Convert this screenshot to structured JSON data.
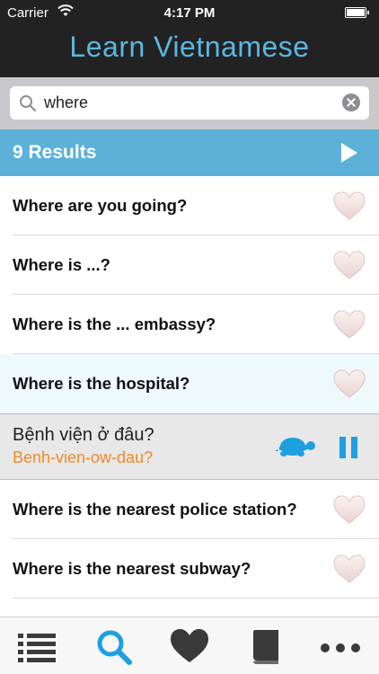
{
  "status_bar": {
    "carrier": "Carrier",
    "time": "4:17 PM"
  },
  "header": {
    "title": "Learn Vietnamese"
  },
  "search": {
    "value": "where"
  },
  "results": {
    "label": "9 Results"
  },
  "list": {
    "rows": [
      {
        "label": "Where are you going?"
      },
      {
        "label": "Where is ...?"
      },
      {
        "label": "Where is the ... embassy?"
      },
      {
        "label": "Where is the hospital?"
      },
      {
        "label": "Where is the nearest police station?"
      },
      {
        "label": "Where is the nearest subway?"
      }
    ],
    "detail": {
      "vietnamese": "Bệnh viện ở đâu?",
      "phonetic": "Benh-vien-ow-dau?"
    }
  },
  "tabbar": {
    "tabs": [
      "list-icon",
      "search-icon",
      "heart-icon",
      "book-icon",
      "more-icon"
    ],
    "active": 1
  },
  "colors": {
    "accent": "#5bb1da",
    "title": "#5bb7e0",
    "phonetic": "#f08a2a",
    "tab_active": "#1da0e0"
  }
}
